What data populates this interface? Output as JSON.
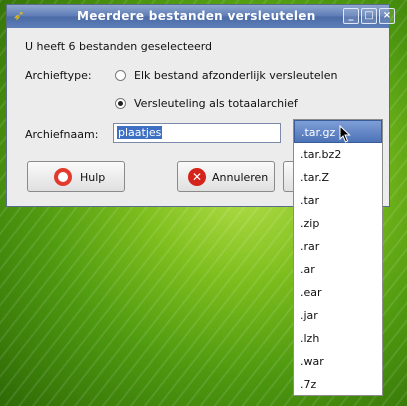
{
  "window": {
    "title": "Meerdere bestanden versleutelen",
    "icon": "key-icon",
    "controls": {
      "minimize": "_",
      "maximize": "□",
      "close": "×"
    }
  },
  "dialog": {
    "selected_count_text": "U heeft 6 bestanden geselecteerd",
    "archive_type_label": "Archieftype:",
    "option_separate": "Elk bestand afzonderlijk versleutelen",
    "option_total": "Versleuteling als totaalarchief",
    "selected_option": "total",
    "archive_name_label": "Archiefnaam:",
    "archive_name_value": "plaatjes"
  },
  "buttons": {
    "help": "Hulp",
    "cancel": "Annuleren"
  },
  "dropdown": {
    "selected": ".tar.gz",
    "options": [
      ".tar.gz",
      ".tar.bz2",
      ".tar.Z",
      ".tar",
      ".zip",
      ".rar",
      ".ar",
      ".ear",
      ".jar",
      ".lzh",
      ".war",
      ".7z"
    ]
  },
  "colors": {
    "titlebar": "#5c7bb5",
    "selection": "#3d6fc3",
    "desktop": "#6fb31a"
  }
}
